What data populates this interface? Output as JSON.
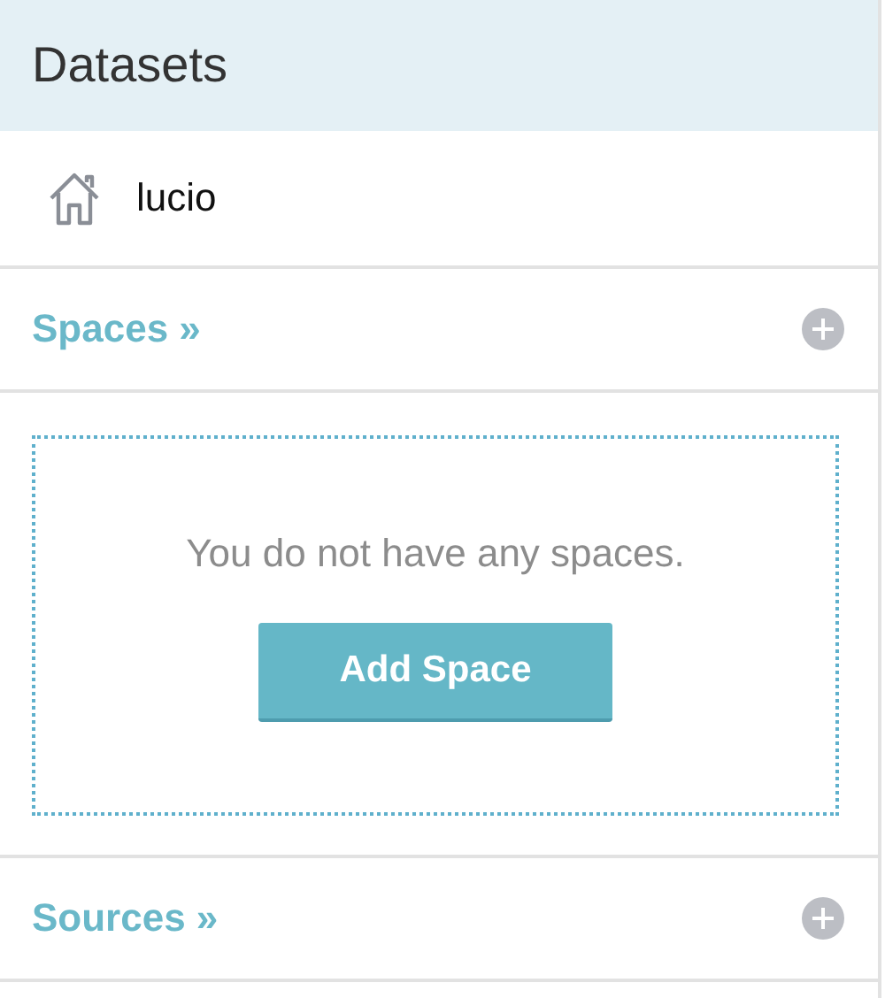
{
  "header": {
    "title": "Datasets"
  },
  "user": {
    "name": "lucio"
  },
  "sections": [
    {
      "kind": "spaces",
      "title": "Spaces »",
      "empty_message": "You do not have any spaces.",
      "button": "Add Space"
    },
    {
      "kind": "sources",
      "title": "Sources »"
    }
  ]
}
